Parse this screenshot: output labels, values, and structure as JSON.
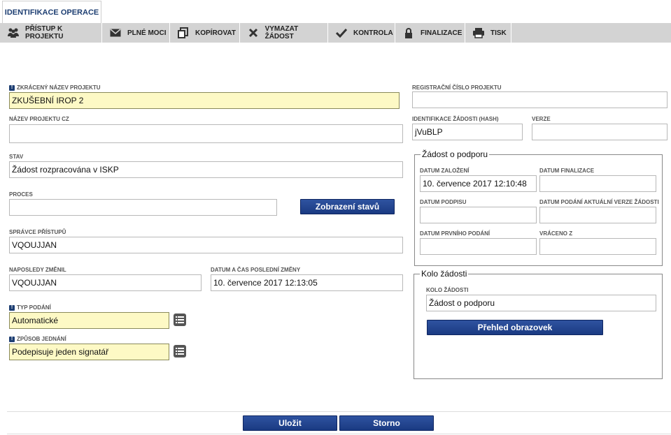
{
  "tab": {
    "label": "IDENTIFIKACE OPERACE"
  },
  "toolbar": [
    {
      "label": "PŘÍSTUP K PROJEKTU",
      "icon": "people-icon"
    },
    {
      "label": "PLNÉ MOCI",
      "icon": "envelope-icon"
    },
    {
      "label": "KOPÍROVAT",
      "icon": "copy-icon"
    },
    {
      "label": "VYMAZAT ŽÁDOST",
      "icon": "delete-icon"
    },
    {
      "label": "KONTROLA",
      "icon": "check-icon"
    },
    {
      "label": "FINALIZACE",
      "icon": "lock-icon"
    },
    {
      "label": "TISK",
      "icon": "printer-icon"
    }
  ],
  "left": {
    "short_name": {
      "label": "ZKRÁCENÝ NÁZEV PROJEKTU",
      "value": "ZKUŠEBNÍ IROP 2"
    },
    "name_cz": {
      "label": "NÁZEV PROJEKTU CZ",
      "value": ""
    },
    "state": {
      "label": "STAV",
      "value": "Žádost rozpracována v ISKP"
    },
    "process": {
      "label": "PROCES",
      "value": ""
    },
    "state_button": "Zobrazení stavů",
    "access_admin": {
      "label": "SPRÁVCE PŘÍSTUPŮ",
      "value": "VQOUJJAN"
    },
    "last_changed_by": {
      "label": "NAPOSLEDY ZMĚNIL",
      "value": "VQOUJJAN"
    },
    "last_change_time": {
      "label": "DATUM A ČAS POSLEDNÍ ZMĚNY",
      "value": "10. července 2017 12:13:05"
    },
    "submission_type": {
      "label": "TYP PODÁNÍ",
      "value": "Automatické"
    },
    "acting_method": {
      "label": "ZPŮSOB JEDNÁNÍ",
      "value": "Podepisuje jeden signatář"
    }
  },
  "right": {
    "reg_number": {
      "label": "REGISTRAČNÍ ČÍSLO PROJEKTU",
      "value": ""
    },
    "hash": {
      "label": "IDENTIFIKACE ŽÁDOSTI (HASH)",
      "value": "jVuBLP"
    },
    "version": {
      "label": "VERZE",
      "value": ""
    },
    "support": {
      "legend": "Žádost o podporu",
      "created": {
        "label": "DATUM ZALOŽENÍ",
        "value": "10. července 2017 12:10:48"
      },
      "finalized": {
        "label": "DATUM FINALIZACE",
        "value": ""
      },
      "signed": {
        "label": "DATUM PODPISU",
        "value": ""
      },
      "last_version_submitted": {
        "label": "DATUM PODÁNÍ AKTUÁLNÍ VERZE ŽÁDOSTI",
        "value": ""
      },
      "first_submitted": {
        "label": "DATUM PRVNÍHO PODÁNÍ",
        "value": ""
      },
      "returned_from": {
        "label": "VRÁCENO Z",
        "value": ""
      }
    },
    "round": {
      "legend": "Kolo žádosti",
      "round_field": {
        "label": "KOLO ŽÁDOSTI",
        "value": "Žádost o podporu"
      },
      "overview_button": "Přehled obrazovek"
    }
  },
  "footer": {
    "save": "Uložit",
    "cancel": "Storno"
  },
  "colors": {
    "accent": "#1d3e72",
    "required_field": "#fdf9c5",
    "toolbar": "#d3d3d3"
  }
}
